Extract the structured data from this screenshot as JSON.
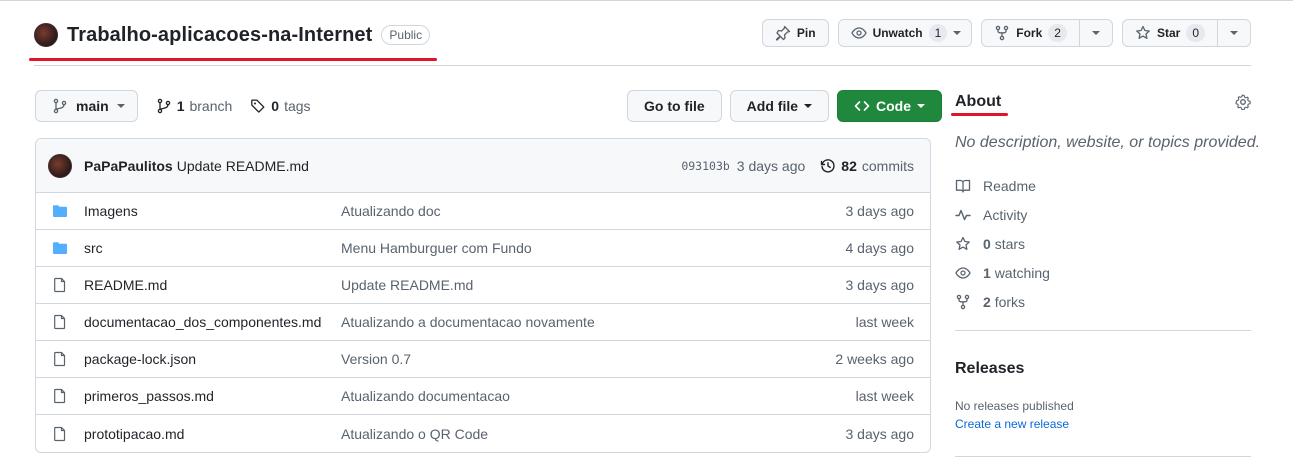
{
  "repo": {
    "name": "Trabalho-aplicacoes-na-Internet",
    "visibility": "Public"
  },
  "header_actions": {
    "pin_label": "Pin",
    "watch_label": "Unwatch",
    "watch_count": "1",
    "fork_label": "Fork",
    "fork_count": "2",
    "star_label": "Star",
    "star_count": "0"
  },
  "toolbar": {
    "branch": "main",
    "branch_count": "1",
    "branch_word": "branch",
    "tags_count": "0",
    "tags_word": "tags",
    "go_to_file": "Go to file",
    "add_file": "Add file",
    "code": "Code"
  },
  "latest_commit": {
    "author": "PaPaPaulitos",
    "message": "Update README.md",
    "sha": "093103b",
    "time": "3 days ago",
    "commit_count": "82",
    "commit_word": "commits"
  },
  "files": [
    {
      "type": "folder",
      "name": "Imagens",
      "message": "Atualizando doc",
      "date": "3 days ago"
    },
    {
      "type": "folder",
      "name": "src",
      "message": "Menu Hamburguer com Fundo",
      "date": "4 days ago"
    },
    {
      "type": "file",
      "name": "README.md",
      "message": "Update README.md",
      "date": "3 days ago"
    },
    {
      "type": "file",
      "name": "documentacao_dos_componentes.md",
      "message": "Atualizando a documentacao novamente",
      "date": "last week"
    },
    {
      "type": "file",
      "name": "package-lock.json",
      "message": "Version 0.7",
      "date": "2 weeks ago"
    },
    {
      "type": "file",
      "name": "primeros_passos.md",
      "message": "Atualizando documentacao",
      "date": "last week"
    },
    {
      "type": "file",
      "name": "prototipacao.md",
      "message": "Atualizando o QR Code",
      "date": "3 days ago"
    }
  ],
  "about": {
    "title": "About",
    "description": "No description, website, or topics provided.",
    "readme": "Readme",
    "activity": "Activity",
    "stars_count": "0",
    "stars_word": "stars",
    "watching_count": "1",
    "watching_word": "watching",
    "forks_count": "2",
    "forks_word": "forks"
  },
  "releases": {
    "title": "Releases",
    "none_text": "No releases published",
    "create_link": "Create a new release"
  },
  "colors": {
    "accent_green": "#1f883d",
    "link_blue": "#0969da",
    "folder_blue": "#54aeff",
    "annotation_red": "#e0142a"
  },
  "icons": {
    "folder": "folder-icon",
    "file": "file-icon"
  }
}
